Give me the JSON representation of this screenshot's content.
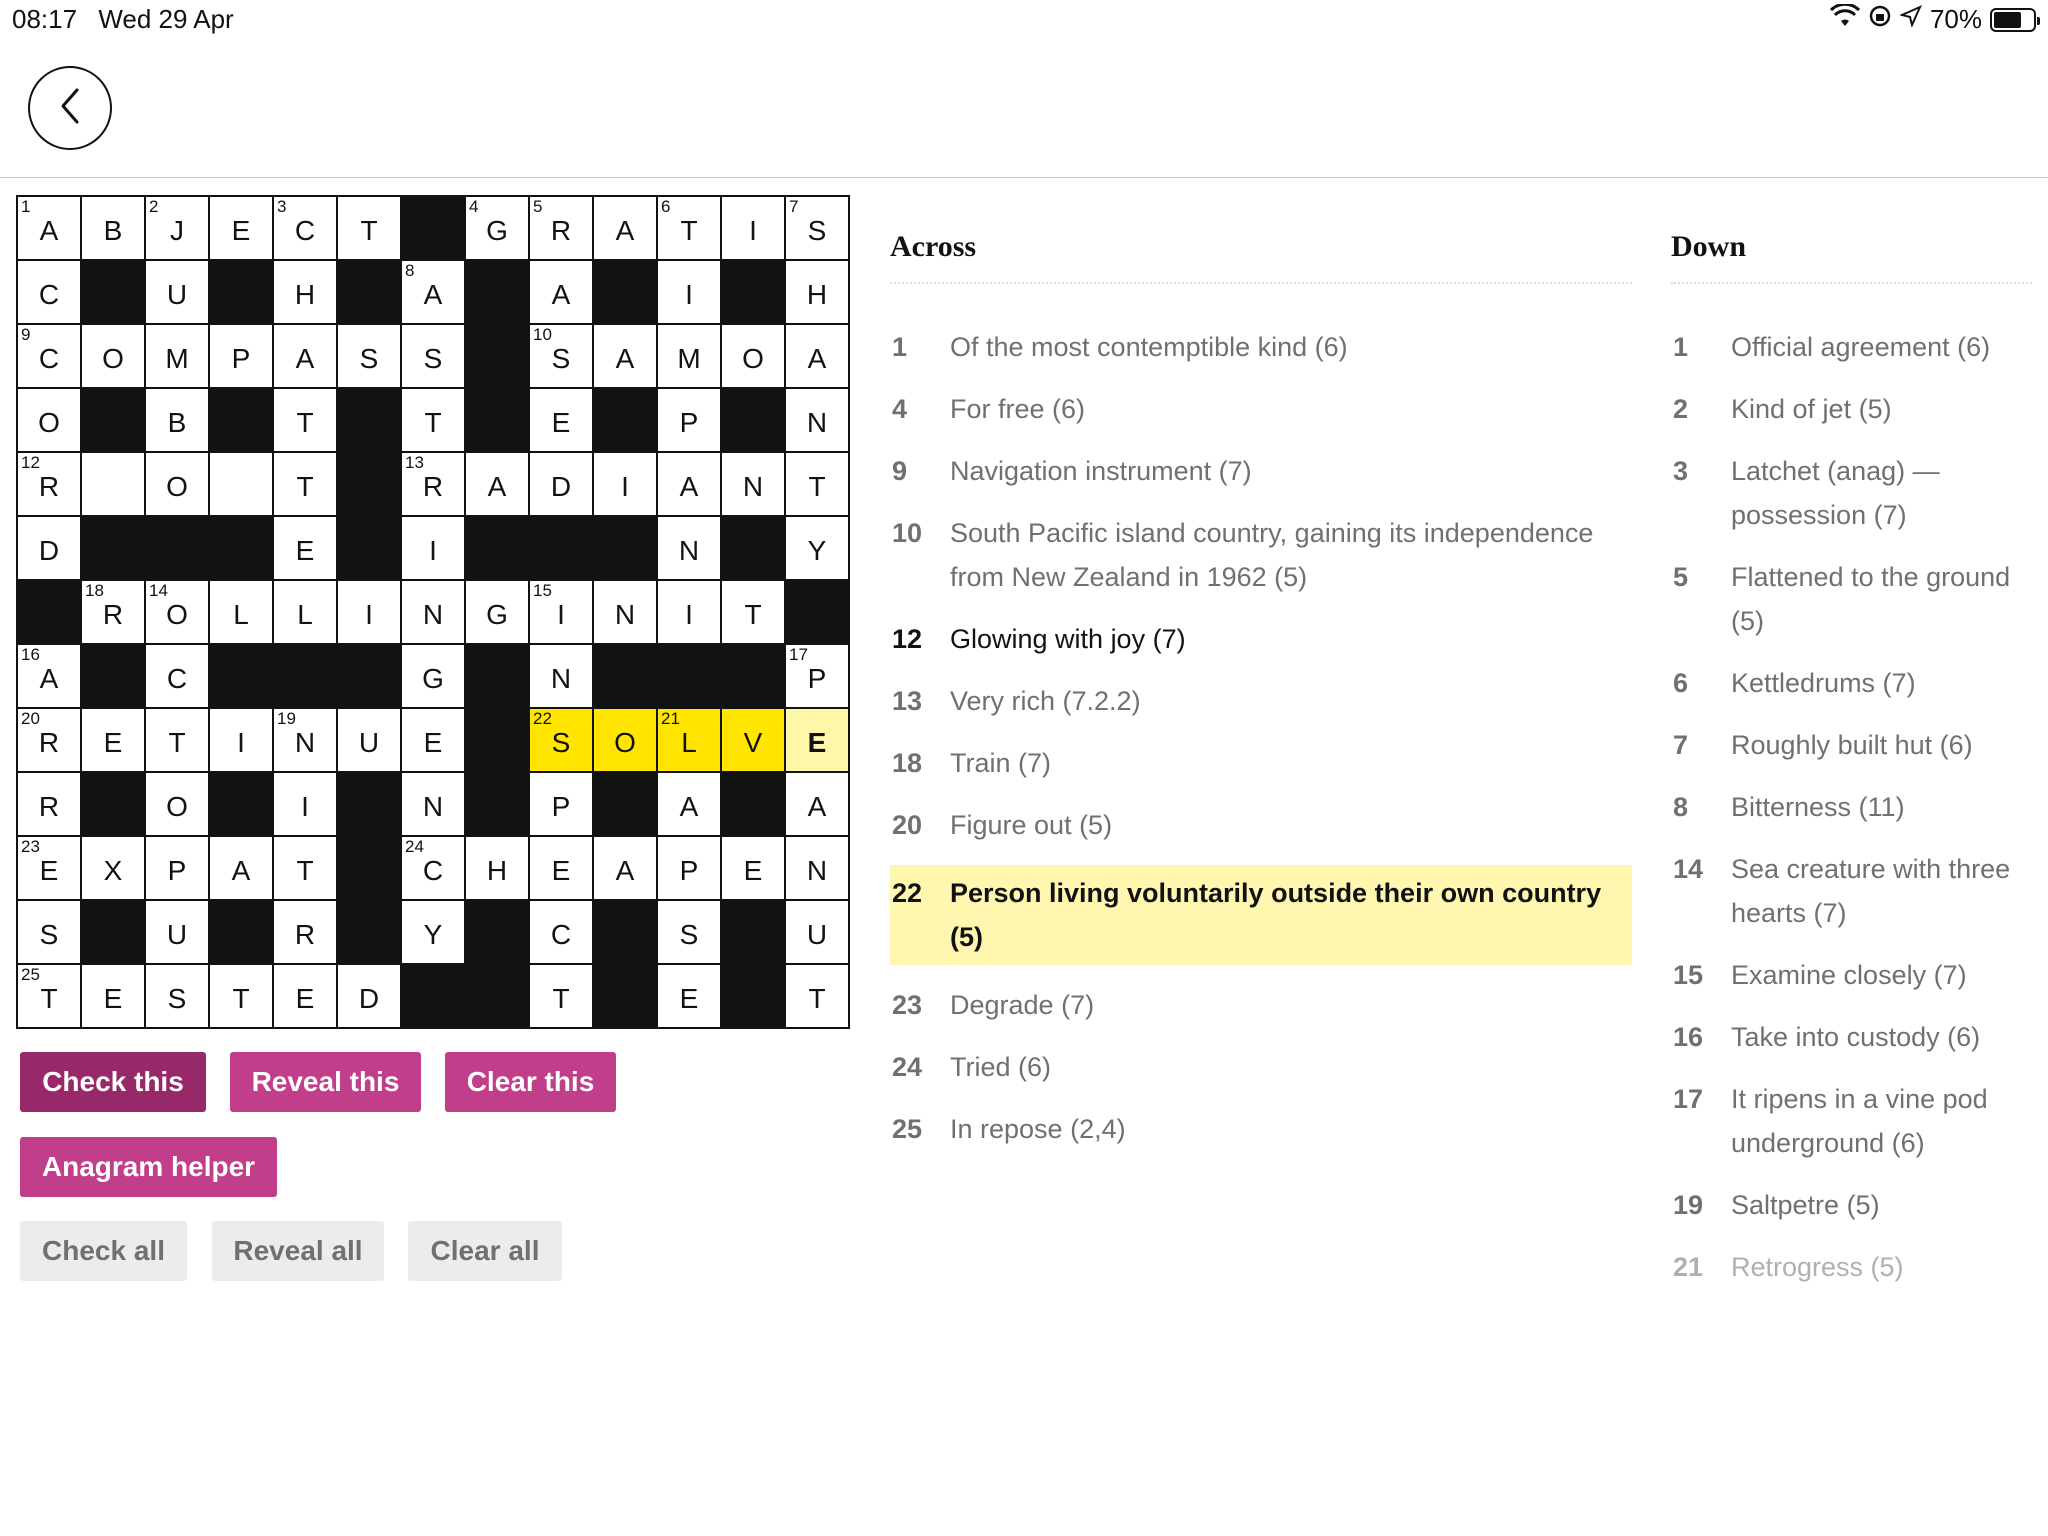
{
  "status_bar": {
    "time": "08:17",
    "date": "Wed 29 Apr",
    "battery": "70%",
    "battery_fraction": 0.7
  },
  "header": {
    "back_icon": "chevron-left-icon"
  },
  "grid": {
    "rows": [
      "ABJECT#GRATIS",
      "C#U#H#A#A#I#H",
      "COMPASS#SAMOA",
      "O#B#T#T#E#P#N",
      "R O T#RADIANT",
      "D###E#I###N#Y",
      "#ROLLINGINIT#",
      "A#C###G#N###P",
      "RETINUE#SOLVE",
      "R#O#I#N#P#A#A",
      "EXPAT#CHEAPEN",
      "S#U#R#Y#C#S#U",
      "TESTED##T#E#T"
    ],
    "numbers": [
      {
        "r": 0,
        "c": 0,
        "n": "1"
      },
      {
        "r": 0,
        "c": 2,
        "n": "2"
      },
      {
        "r": 0,
        "c": 4,
        "n": "3"
      },
      {
        "r": 0,
        "c": 7,
        "n": "4"
      },
      {
        "r": 0,
        "c": 8,
        "n": "5"
      },
      {
        "r": 0,
        "c": 10,
        "n": "6"
      },
      {
        "r": 0,
        "c": 12,
        "n": "7"
      },
      {
        "r": 1,
        "c": 6,
        "n": "8"
      },
      {
        "r": 2,
        "c": 0,
        "n": "9"
      },
      {
        "r": 2,
        "c": 8,
        "n": "10"
      },
      {
        "r": 4,
        "c": 0,
        "n": "12"
      },
      {
        "r": 4,
        "c": 6,
        "n": "13"
      },
      {
        "r": 6,
        "c": 1,
        "n": "18"
      },
      {
        "r": 6,
        "c": 2,
        "n": "14"
      },
      {
        "r": 6,
        "c": 8,
        "n": "15"
      },
      {
        "r": 7,
        "c": 0,
        "n": "16"
      },
      {
        "r": 7,
        "c": 12,
        "n": "17"
      },
      {
        "r": 8,
        "c": 0,
        "n": "20"
      },
      {
        "r": 8,
        "c": 4,
        "n": "19"
      },
      {
        "r": 8,
        "c": 8,
        "n": "22"
      },
      {
        "r": 8,
        "c": 10,
        "n": "21"
      },
      {
        "r": 10,
        "c": 0,
        "n": "23"
      },
      {
        "r": 10,
        "c": 6,
        "n": "24"
      },
      {
        "r": 12,
        "c": 0,
        "n": "25"
      }
    ],
    "highlight": {
      "row": 8,
      "from_col": 8,
      "to_col": 11
    },
    "cursor": {
      "row": 8,
      "col": 12
    },
    "highlight_color": "#ffe500",
    "cursor_color": "#fff7a8"
  },
  "buttons": {
    "check_this": "Check this",
    "reveal_this": "Reveal this",
    "clear_this": "Clear this",
    "anagram_helper": "Anagram helper",
    "check_all": "Check all",
    "reveal_all": "Reveal all",
    "clear_all": "Clear all"
  },
  "across": {
    "title": "Across",
    "clues": [
      {
        "num": "1",
        "text": "Of the most contemptible kind (6)",
        "state": "normal"
      },
      {
        "num": "4",
        "text": "For free (6)",
        "state": "normal"
      },
      {
        "num": "9",
        "text": "Navigation instrument (7)",
        "state": "normal"
      },
      {
        "num": "10",
        "text": "South Pacific island country, gaining its independence from New Zealand in 1962 (5)",
        "state": "normal"
      },
      {
        "num": "12",
        "text": "Glowing with joy (7)",
        "state": "bold"
      },
      {
        "num": "13",
        "text": "Very rich (7.2.2)",
        "state": "normal"
      },
      {
        "num": "18",
        "text": "Train (7)",
        "state": "normal"
      },
      {
        "num": "20",
        "text": "Figure out (5)",
        "state": "normal"
      },
      {
        "num": "22",
        "text": "Person living voluntarily outside their own country (5)",
        "state": "selected"
      },
      {
        "num": "23",
        "text": "Degrade (7)",
        "state": "normal"
      },
      {
        "num": "24",
        "text": "Tried (6)",
        "state": "normal"
      },
      {
        "num": "25",
        "text": "In repose (2,4)",
        "state": "normal"
      }
    ]
  },
  "down": {
    "title": "Down",
    "clues": [
      {
        "num": "1",
        "text": "Official agreement (6)",
        "state": "normal"
      },
      {
        "num": "2",
        "text": "Kind of jet (5)",
        "state": "normal"
      },
      {
        "num": "3",
        "text": "Latchet (anag) — possession (7)",
        "state": "normal"
      },
      {
        "num": "5",
        "text": "Flattened to the ground (5)",
        "state": "normal"
      },
      {
        "num": "6",
        "text": "Kettledrums (7)",
        "state": "normal"
      },
      {
        "num": "7",
        "text": "Roughly built hut (6)",
        "state": "normal"
      },
      {
        "num": "8",
        "text": "Bitterness (11)",
        "state": "normal"
      },
      {
        "num": "14",
        "text": "Sea creature with three hearts (7)",
        "state": "normal"
      },
      {
        "num": "15",
        "text": "Examine closely (7)",
        "state": "normal"
      },
      {
        "num": "16",
        "text": "Take into custody (6)",
        "state": "normal"
      },
      {
        "num": "17",
        "text": "It ripens in a vine pod underground (6)",
        "state": "normal"
      },
      {
        "num": "19",
        "text": "Saltpetre (5)",
        "state": "normal"
      },
      {
        "num": "21",
        "text": "Retrogress (5)",
        "state": "faded"
      }
    ]
  },
  "colors": {
    "pink": "#c13e8a",
    "pink_pressed": "#97286a",
    "grey_button": "#ececec",
    "selected_clue": "#fff7b0"
  }
}
